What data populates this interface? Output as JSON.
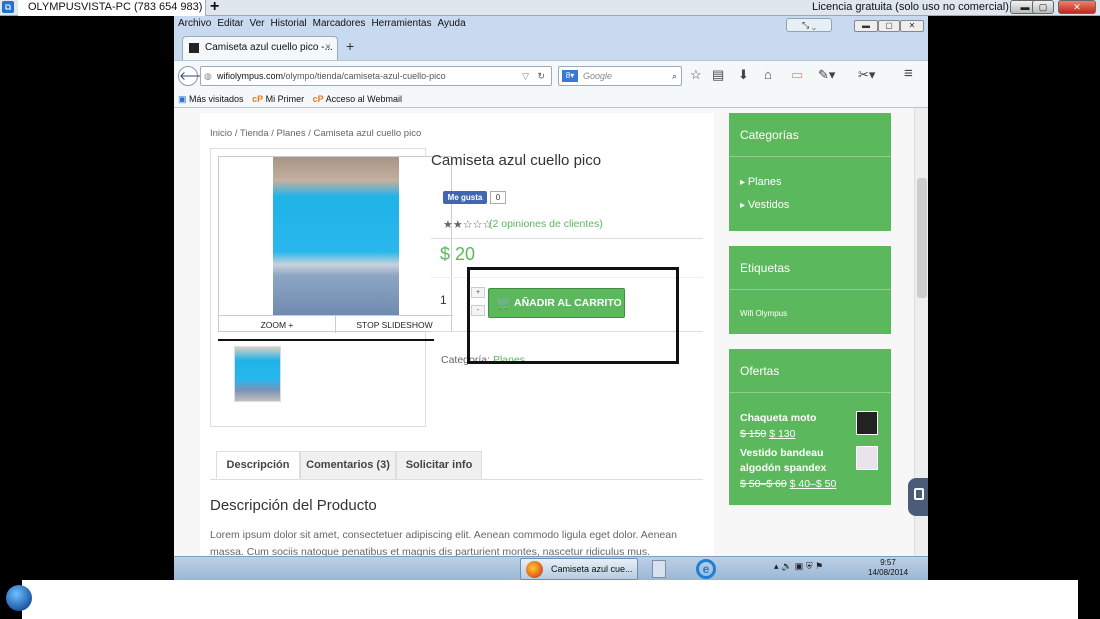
{
  "remote": {
    "tab_title": "OLYMPUSVISTA-PC (783 654 983)",
    "plus": "+",
    "license": "Licencia gratuita (solo uso no comercial)"
  },
  "menu": [
    "Archivo",
    "Editar",
    "Ver",
    "Historial",
    "Marcadores",
    "Herramientas",
    "Ayuda"
  ],
  "browser": {
    "tab_title": "Camiseta azul cuello pico -...",
    "tab_close": "×",
    "newtab": "+",
    "url_domain": "wifiolympus.com",
    "url_path": "/olympo/tienda/camiseta-azul-cuello-pico",
    "search_placeholder": "Google"
  },
  "bookmarks": [
    "Más visitados",
    "Mi Primer",
    "Acceso al Webmail"
  ],
  "breadcrumb": "Inicio / Tienda / Planes / Camiseta azul cuello pico",
  "gallery": {
    "zoom": "ZOOM +",
    "stop": "STOP SLIDESHOW"
  },
  "product": {
    "title": "Camiseta azul cuello pico",
    "fb_like": "Me gusta",
    "fb_count": "0",
    "stars": "★★☆☆☆",
    "rating_stars": 2,
    "reviews": "(2 opiniones de clientes)",
    "price": "$ 20",
    "qty": "1",
    "plus": "+",
    "minus": "-",
    "add_to_cart": "AÑADIR AL CARRITO",
    "category_label": "Categoría:",
    "category_value": "Planes."
  },
  "tabs": [
    "Descripción",
    "Comentarios (3)",
    "Solicitar info"
  ],
  "description": {
    "title": "Descripción del Producto",
    "text": "Lorem ipsum dolor sit amet, consectetuer adipiscing elit. Aenean commodo ligula eget dolor. Aenean massa. Cum sociis natoque penatibus et magnis dis parturient montes, nascetur ridiculus mus."
  },
  "sidebar": {
    "categories_title": "Categorías",
    "categories": [
      "Planes",
      "Vestidos"
    ],
    "tags_title": "Etiquetas",
    "tag": "Wifi Olympus",
    "offers_title": "Ofertas",
    "offers": [
      {
        "name1": "Chaqueta moto",
        "name2": "",
        "old": "$ 150",
        "new": "$ 130"
      },
      {
        "name1": "Vestido bandeau",
        "name2": "algodón spandex",
        "old": "$ 50–$ 60",
        "new": "$ 40–$ 50"
      }
    ]
  },
  "taskbar": {
    "button": "Camiseta azul cue...",
    "time": "9:57",
    "date": "14/08/2014"
  },
  "colors": {
    "accent": "#5cb85c",
    "facebook": "#4267b2"
  }
}
